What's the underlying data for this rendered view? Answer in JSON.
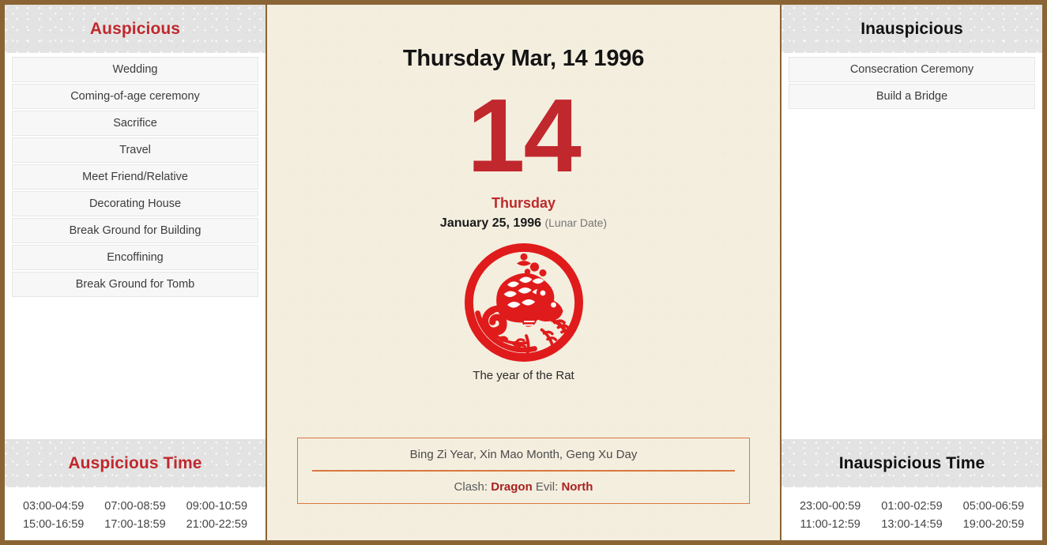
{
  "theme": {
    "frame_color": "#8a6434",
    "accent_red": "#c0282d",
    "paper_bg": "#f4eedf",
    "band_bg": "#e3e3e3",
    "box_border": "#d9793f"
  },
  "left_panel": {
    "header": "Auspicious",
    "items": [
      "Wedding",
      "Coming-of-age ceremony",
      "Sacrifice",
      "Travel",
      "Meet Friend/Relative",
      "Decorating House",
      "Break Ground for Building",
      "Encoffining",
      "Break Ground for Tomb"
    ],
    "time_header": "Auspicious Time",
    "times": [
      "03:00-04:59",
      "07:00-08:59",
      "09:00-10:59",
      "15:00-16:59",
      "17:00-18:59",
      "21:00-22:59"
    ]
  },
  "center_panel": {
    "gregorian_date": "Thursday Mar, 14 1996",
    "day_number": "14",
    "weekday": "Thursday",
    "lunar_date": "January 25, 1996",
    "lunar_note": "(Lunar Date)",
    "zodiac_icon": "rat-papercut-icon",
    "zodiac_caption": "The year of the Rat",
    "ganzhi": "Bing Zi Year, Xin Mao Month, Geng Xu Day",
    "clash_label": "Clash:",
    "clash_value": "Dragon",
    "evil_label": "Evil:",
    "evil_value": "North"
  },
  "right_panel": {
    "header": "Inauspicious",
    "items": [
      "Consecration Ceremony",
      "Build a Bridge"
    ],
    "time_header": "Inauspicious Time",
    "times": [
      "23:00-00:59",
      "01:00-02:59",
      "05:00-06:59",
      "11:00-12:59",
      "13:00-14:59",
      "19:00-20:59"
    ]
  }
}
